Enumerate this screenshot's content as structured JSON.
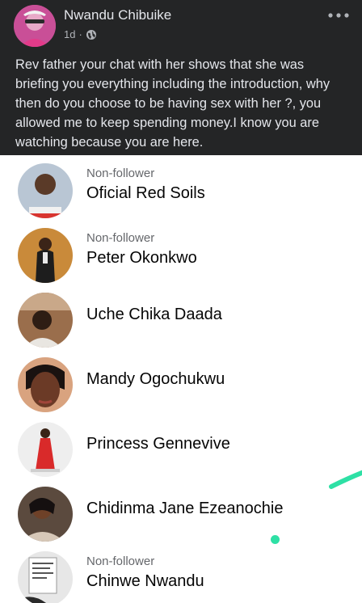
{
  "post": {
    "author": "Nwandu Chibuike",
    "time": "1d",
    "separator": "·",
    "more_icon": "more-horizontal-icon",
    "text": "Rev father your chat with her shows that she was briefing you everything including the introduction, why then do you choose to be having sex with her ?, you allowed me to keep spending money.I know you are watching because you are here."
  },
  "people": [
    {
      "subtitle": "Non-follower",
      "name": "Oficial Red Soils"
    },
    {
      "subtitle": "Non-follower",
      "name": "Peter Okonkwo"
    },
    {
      "subtitle": "",
      "name": "Uche Chika Daada"
    },
    {
      "subtitle": "",
      "name": "Mandy Ogochukwu"
    },
    {
      "subtitle": "",
      "name": "Princess Gennevive"
    },
    {
      "subtitle": "",
      "name": "Chidinma Jane Ezeanochie"
    },
    {
      "subtitle": "Non-follower",
      "name": "Chinwe Nwandu"
    }
  ],
  "colors": {
    "post_background": "#242526",
    "post_text": "#e4e6eb",
    "meta_text": "#b0b3b8",
    "list_background": "#ffffff",
    "name_text": "#050505",
    "subtitle_text": "#65676b",
    "annotation_green": "#2ee0a5"
  }
}
